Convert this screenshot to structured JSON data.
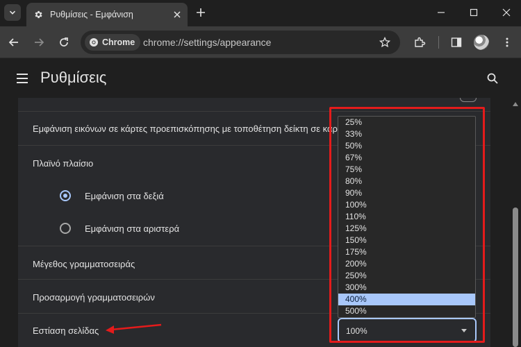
{
  "browser": {
    "tab_title": "Ρυθμίσεις - Εμφάνιση",
    "chip_label": "Chrome",
    "url": "chrome://settings/appearance"
  },
  "settings": {
    "title": "Ρυθμίσεις",
    "partial_top_label": "· · · · · ·",
    "rows": {
      "tab_previews": "Εμφάνιση εικόνων σε κάρτες προεπισκόπησης με τοποθέτηση δείκτη σε καρτ",
      "side_panel": "Πλαϊνό πλαίσιο",
      "side_right": "Εμφάνιση στα δεξιά",
      "side_left": "Εμφάνιση στα αριστερά",
      "font_size": "Μέγεθος γραμματοσειράς",
      "customize_fonts": "Προσαρμογή γραμματοσειρών",
      "page_zoom": "Εστίαση σελίδας"
    },
    "page_zoom_value": "100%",
    "zoom_options": [
      "25%",
      "33%",
      "50%",
      "67%",
      "75%",
      "80%",
      "90%",
      "100%",
      "110%",
      "125%",
      "150%",
      "175%",
      "200%",
      "250%",
      "300%",
      "400%",
      "500%"
    ],
    "zoom_highlighted": "400%"
  },
  "colors": {
    "accent": "#a8c7fa",
    "annotation": "#e41b1b"
  }
}
